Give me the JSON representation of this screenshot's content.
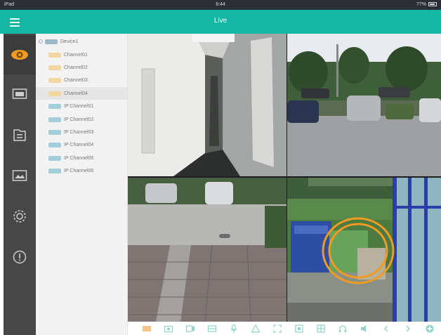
{
  "status_bar": {
    "left": "iPad",
    "time": "8:44",
    "right": "77%"
  },
  "header": {
    "title": "Live",
    "menu_icon": "hamburger-menu-icon"
  },
  "sidebar": {
    "items": [
      {
        "name": "live-view",
        "icon": "eye-icon",
        "active": true
      },
      {
        "name": "playback",
        "icon": "video-playback-icon",
        "active": false
      },
      {
        "name": "file-manager",
        "icon": "folder-icon",
        "active": false
      },
      {
        "name": "pictures",
        "icon": "image-icon",
        "active": false
      },
      {
        "name": "settings",
        "icon": "gear-icon",
        "active": false
      },
      {
        "name": "about",
        "icon": "info-icon",
        "active": false
      }
    ]
  },
  "device_tree": {
    "device": "Device1",
    "channels": [
      {
        "label": "Channel01",
        "kind": "analog",
        "selected": false
      },
      {
        "label": "Channel02",
        "kind": "analog",
        "selected": false
      },
      {
        "label": "Channel03",
        "kind": "analog",
        "selected": false
      },
      {
        "label": "Channel04",
        "kind": "analog",
        "selected": true
      },
      {
        "label": "IP Channel01",
        "kind": "ip",
        "selected": false
      },
      {
        "label": "IP Channel02",
        "kind": "ip",
        "selected": false
      },
      {
        "label": "IP Channel03",
        "kind": "ip",
        "selected": false
      },
      {
        "label": "IP Channel04",
        "kind": "ip",
        "selected": false
      },
      {
        "label": "IP Channel05",
        "kind": "ip",
        "selected": false
      },
      {
        "label": "IP Channel06",
        "kind": "ip",
        "selected": false
      }
    ]
  },
  "video_tiles": [
    {
      "scene": "hallway"
    },
    {
      "scene": "parking-lot"
    },
    {
      "scene": "courtyard"
    },
    {
      "scene": "glass-entrance"
    }
  ],
  "annotation": {
    "color": "#f29b22"
  },
  "toolbar": {
    "buttons": [
      {
        "icon": "layout-icon",
        "active": true
      },
      {
        "icon": "snapshot-icon"
      },
      {
        "icon": "record-icon"
      },
      {
        "icon": "stream-icon"
      },
      {
        "icon": "microphone-icon"
      },
      {
        "icon": "ptz-icon"
      },
      {
        "icon": "zoom-icon"
      },
      {
        "icon": "fullscreen-icon"
      },
      {
        "icon": "grid-icon"
      },
      {
        "icon": "audio-icon"
      },
      {
        "icon": "speaker-icon"
      },
      {
        "icon": "previous-icon"
      },
      {
        "icon": "next-icon"
      },
      {
        "icon": "add-icon"
      }
    ]
  },
  "colors": {
    "accent": "#15b5a3",
    "rail": "#474747",
    "eye_active": "#f29b22"
  }
}
